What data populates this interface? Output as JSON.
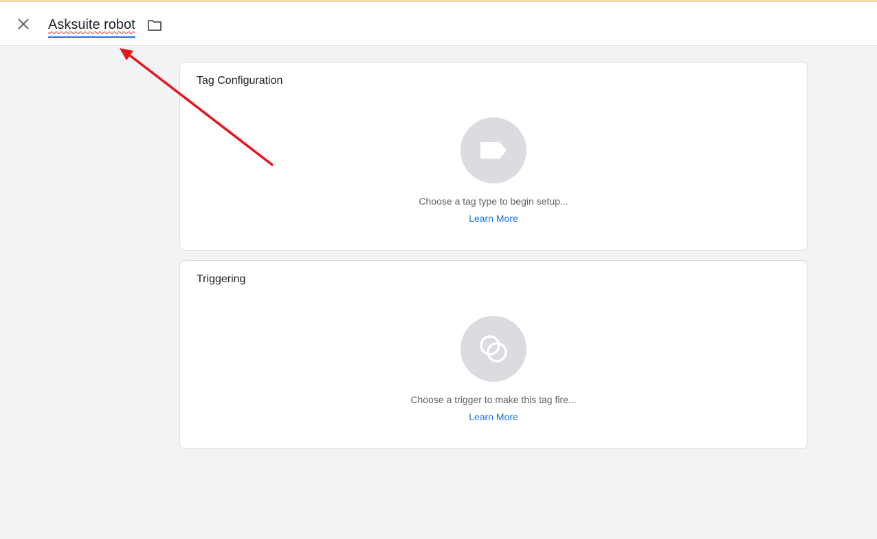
{
  "header": {
    "title": "Asksuite robot",
    "close_icon": "close-icon",
    "folder_icon": "folder-icon"
  },
  "cards": {
    "tag_configuration": {
      "title": "Tag Configuration",
      "icon": "tag-icon",
      "description": "Choose a tag type to begin setup...",
      "link": "Learn More"
    },
    "triggering": {
      "title": "Triggering",
      "icon": "trigger-icon",
      "description": "Choose a trigger to make this tag fire...",
      "link": "Learn More"
    }
  },
  "colors": {
    "accent": "#1a73e8",
    "annotation": "#e8141c",
    "icon_circle": "#dadce0",
    "background": "#f1f3f4"
  }
}
